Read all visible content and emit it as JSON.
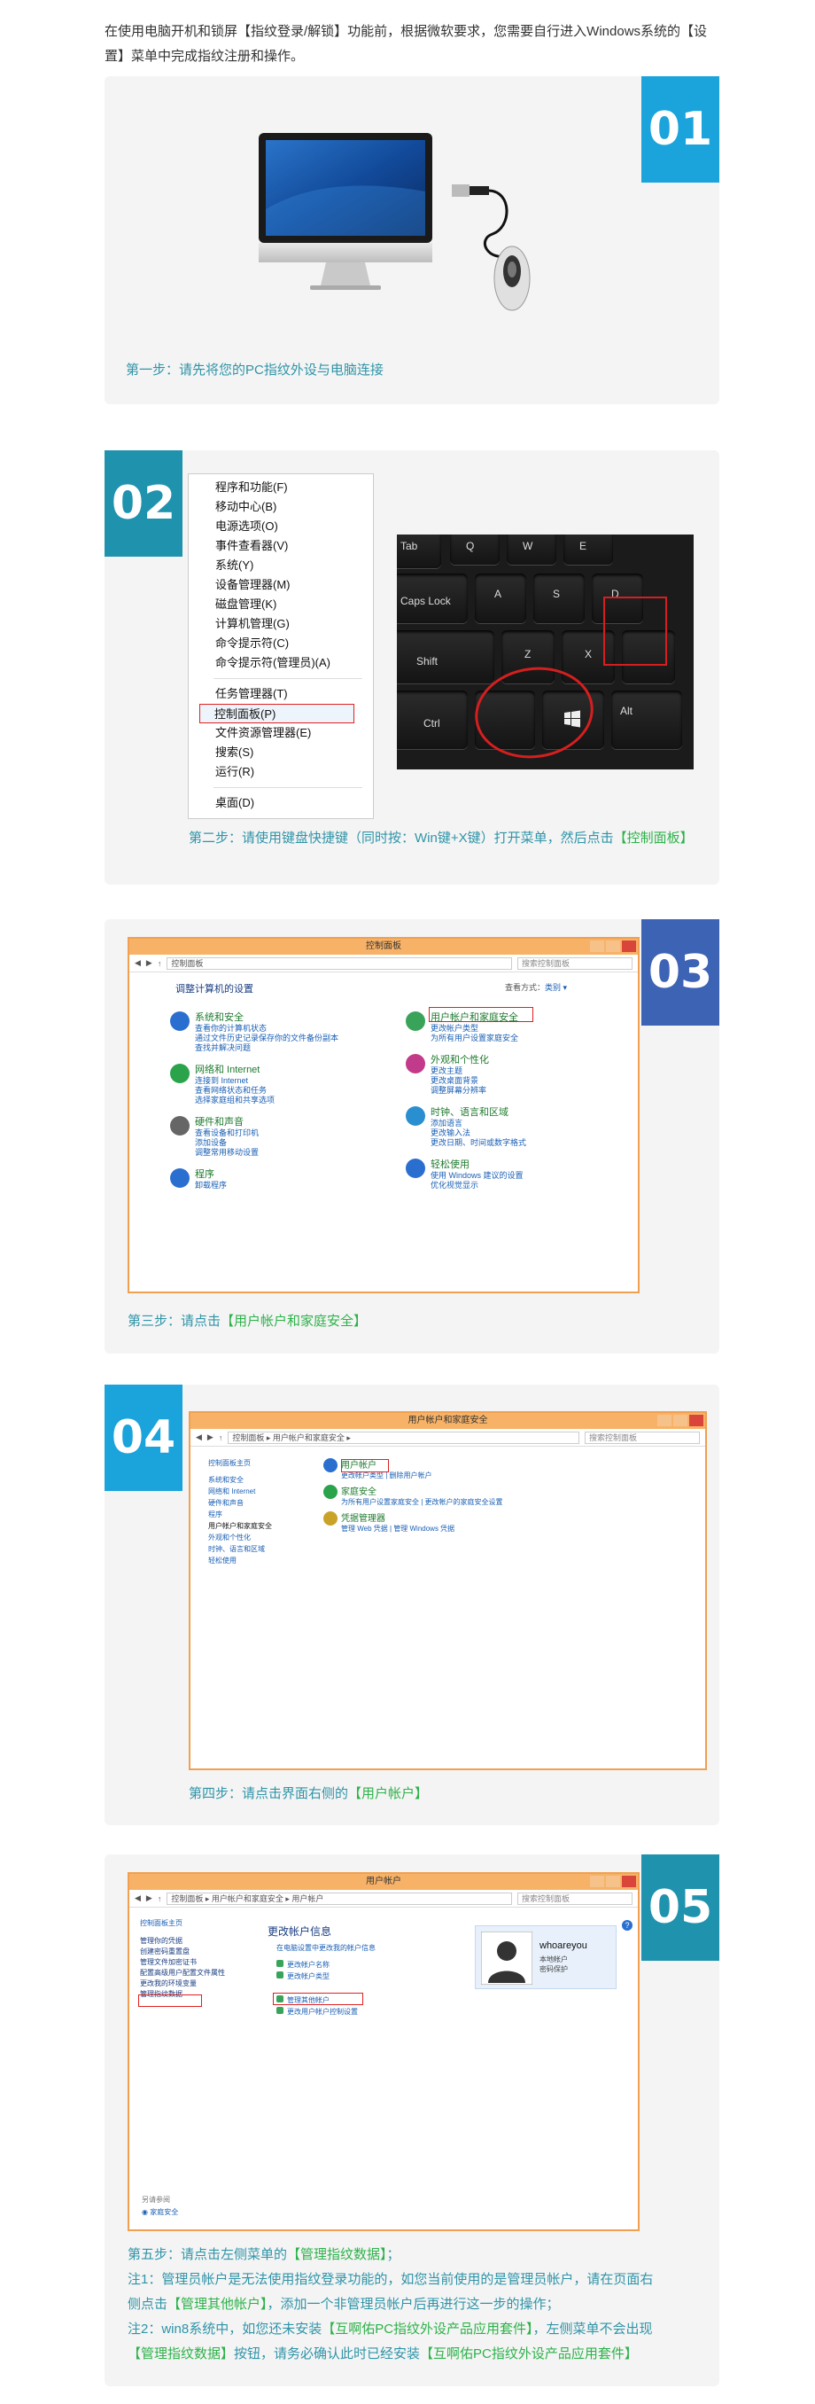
{
  "intro": "在使用电脑开机和锁屏【指纹登录/解锁】功能前，根据微软要求，您需要自行进入Windows系统的【设置】菜单中完成指纹注册和操作。",
  "colors": {
    "blue": "#1ba3dc",
    "teal": "#1f93ad",
    "indigo": "#3c63b4",
    "step_text": "#2f94a8",
    "highlight": "#2db24a",
    "card_bg": "#f4f4f4"
  },
  "step1": {
    "number": "01",
    "text": "第一步：请先将您的PC指纹外设与电脑连接"
  },
  "step2": {
    "number": "02",
    "menu_items_a": [
      "程序和功能(F)",
      "移动中心(B)",
      "电源选项(O)",
      "事件查看器(V)",
      "系统(Y)",
      "设备管理器(M)",
      "磁盘管理(K)",
      "计算机管理(G)",
      "命令提示符(C)",
      "命令提示符(管理员)(A)"
    ],
    "menu_items_b": [
      "任务管理器(T)",
      "控制面板(P)",
      "文件资源管理器(E)",
      "搜索(S)",
      "运行(R)"
    ],
    "menu_items_c": [
      "桌面(D)"
    ],
    "keys": {
      "tab": "Tab",
      "q": "Q",
      "w": "W",
      "e": "E",
      "caps": "Caps Lock",
      "a": "A",
      "s": "S",
      "d": "D",
      "shift": "Shift",
      "z": "Z",
      "x": "X",
      "ctrl": "Ctrl",
      "alt": "Alt"
    },
    "text_prefix": "第二步：请使用键盘快捷键（同时按：Win键+X键）打开菜单，然后点击",
    "text_highlight": "【控制面板】"
  },
  "step3": {
    "number": "03",
    "window_title": "控制面板",
    "address": "控制面板",
    "search_placeholder": "搜索控制面板",
    "heading": "调整计算机的设置",
    "view_by": "查看方式：",
    "view_by_value": "类别 ▾",
    "categories_left": [
      {
        "title": "系统和安全",
        "links": [
          "查看你的计算机状态",
          "通过文件历史记录保存你的文件备份副本",
          "查找并解决问题"
        ]
      },
      {
        "title": "网络和 Internet",
        "links": [
          "连接到 Internet",
          "查看网络状态和任务",
          "选择家庭组和共享选项"
        ]
      },
      {
        "title": "硬件和声音",
        "links": [
          "查看设备和打印机",
          "添加设备",
          "调整常用移动设置"
        ]
      },
      {
        "title": "程序",
        "links": [
          "卸载程序"
        ]
      }
    ],
    "categories_right": [
      {
        "title": "用户帐户和家庭安全",
        "links": [
          "更改帐户类型",
          "为所有用户设置家庭安全"
        ]
      },
      {
        "title": "外观和个性化",
        "links": [
          "更改主题",
          "更改桌面背景",
          "调整屏幕分辨率"
        ]
      },
      {
        "title": "时钟、语言和区域",
        "links": [
          "添加语言",
          "更改输入法",
          "更改日期、时间或数字格式"
        ]
      },
      {
        "title": "轻松使用",
        "links": [
          "使用 Windows 建议的设置",
          "优化视觉显示"
        ]
      }
    ],
    "text_prefix": "第三步：请点击",
    "text_highlight": "【用户帐户和家庭安全】"
  },
  "step4": {
    "number": "04",
    "window_title": "用户帐户和家庭安全",
    "address": "控制面板 ▸ 用户帐户和家庭安全 ▸",
    "search_placeholder": "搜索控制面板",
    "sidebar": [
      "控制面板主页",
      "系统和安全",
      "网络和 Internet",
      "硬件和声音",
      "程序",
      "用户帐户和家庭安全",
      "外观和个性化",
      "时钟、语言和区域",
      "轻松使用"
    ],
    "sections": [
      {
        "title": "用户帐户",
        "links": [
          "更改帐户类型",
          "删除用户帐户"
        ]
      },
      {
        "title": "家庭安全",
        "links": [
          "为所有用户设置家庭安全",
          "更改帐户的家庭安全设置"
        ]
      },
      {
        "title": "凭据管理器",
        "links": [
          "管理 Web 凭据",
          "管理 Windows 凭据"
        ]
      }
    ],
    "text_prefix": "第四步：请点击界面右侧的",
    "text_highlight": "【用户帐户】"
  },
  "step5": {
    "number": "05",
    "window_title": "用户帐户",
    "address": "控制面板 ▸ 用户帐户和家庭安全 ▸ 用户帐户",
    "search_placeholder": "搜索控制面板",
    "sidebar": [
      "控制面板主页",
      "管理你的凭据",
      "创建密码重置盘",
      "管理文件加密证书",
      "配置高级用户配置文件属性",
      "更改我的环境变量",
      "管理指纹数据"
    ],
    "see_also": "另请参阅",
    "family_safety": "家庭安全",
    "heading": "更改帐户信息",
    "pc_settings_link": "在电脑设置中更改我的帐户信息",
    "links": [
      "更改帐户名称",
      "更改帐户类型"
    ],
    "links2": [
      "管理其他帐户",
      "更改用户帐户控制设置"
    ],
    "user_name": "whoareyou",
    "user_type": "本地帐户",
    "user_status": "密码保护",
    "text_line1_prefix": "第五步：请点击左侧菜单的",
    "text_line1_highlight": "【管理指纹数据】",
    "text_line1_suffix": "；",
    "note1_prefix": "注1：管理员帐户是无法使用指纹登录功能的，如您当前使用的是管理员帐户，请在页面右侧点击",
    "note1_highlight": "【管理其他帐户】",
    "note1_suffix": "，添加一个非管理员帐户后再进行这一步的操作；",
    "note2_prefix": "注2：win8系统中，如您还未安装",
    "note2_highlight1": "【互啊佑PC指纹外设产品应用套件】",
    "note2_mid1": "，左侧菜单不会出现",
    "note2_highlight2": "【管理指纹数据】",
    "note2_mid2": "按钮，请务必确认此时已经安装",
    "note2_highlight3": "【互啊佑PC指纹外设产品应用套件】"
  }
}
